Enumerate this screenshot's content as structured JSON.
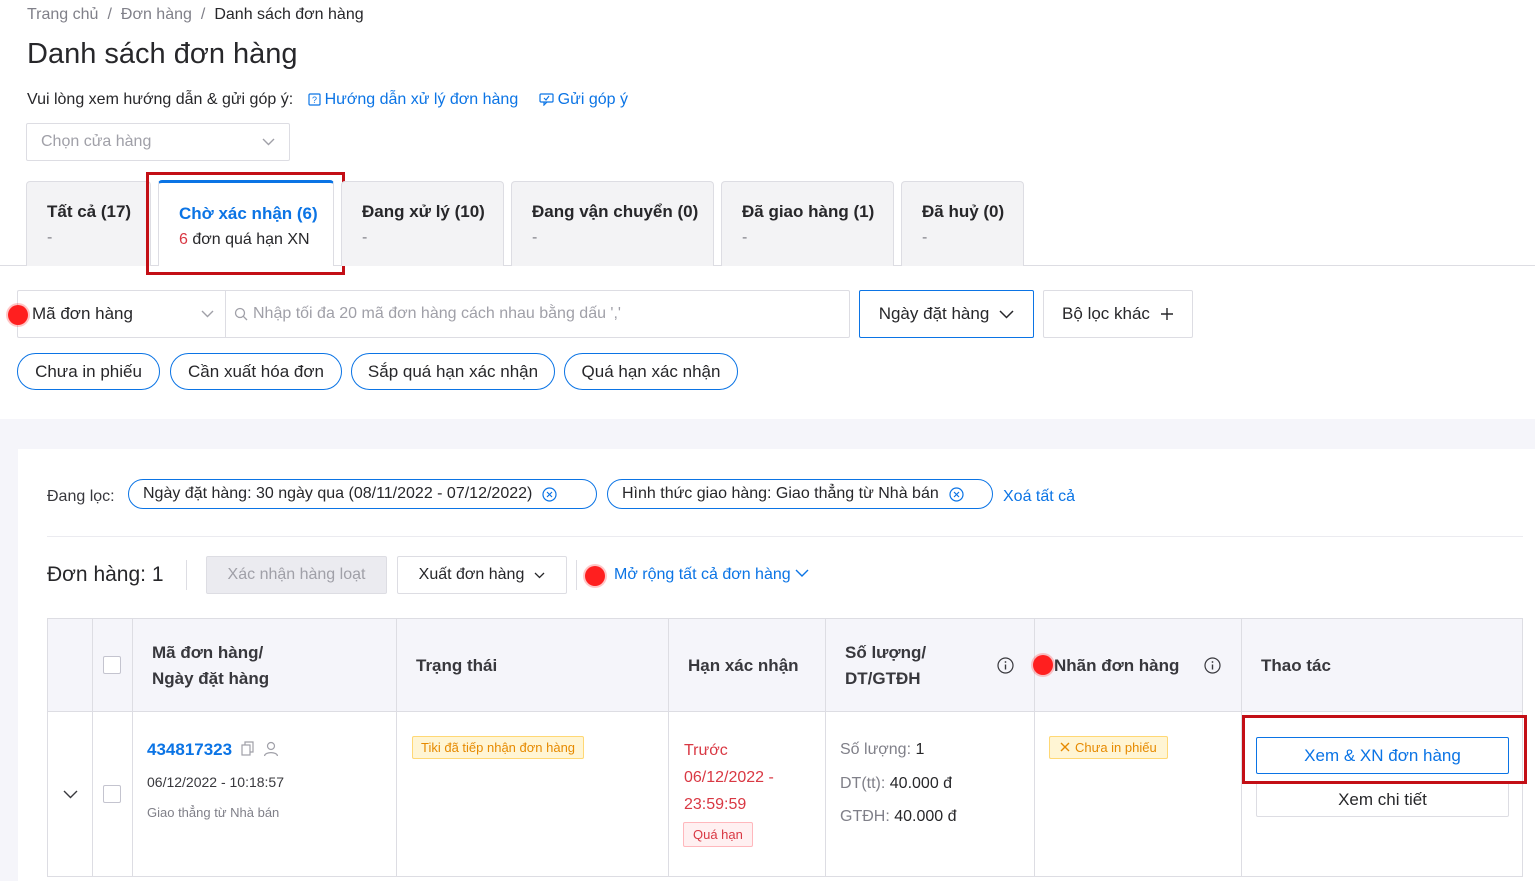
{
  "breadcrumb": {
    "home": "Trang chủ",
    "orders": "Đơn hàng",
    "current": "Danh sách đơn hàng"
  },
  "page_title": "Danh sách đơn hàng",
  "guide": {
    "text": "Vui lòng xem hướng dẫn & gửi góp ý:",
    "link1": "Hướng dẫn xử lý đơn hàng",
    "link2": "Gửi góp ý"
  },
  "store_select": {
    "placeholder": "Chọn cửa hàng"
  },
  "tabs": [
    {
      "label": "Tất cả (17)",
      "sub": "-"
    },
    {
      "label": "Chờ xác nhận (6)",
      "sub_num": "6",
      "sub_text": " đơn quá hạn XN"
    },
    {
      "label": "Đang xử lý (10)",
      "sub": "-"
    },
    {
      "label": "Đang vận chuyển (0)",
      "sub": "-"
    },
    {
      "label": "Đã giao hàng (1)",
      "sub": "-"
    },
    {
      "label": "Đã huỷ (0)",
      "sub": "-"
    }
  ],
  "search": {
    "field_select": "Mã đơn hàng",
    "placeholder": "Nhập tối đa 20 mã đơn hàng cách nhau bằng dấu ','",
    "date_button": "Ngày đặt hàng",
    "more_filters": "Bộ lọc khác"
  },
  "quick_filters": [
    "Chưa in phiếu",
    "Cần xuất hóa đơn",
    "Sắp quá hạn xác nhận",
    "Quá hạn xác nhận"
  ],
  "active_filters": {
    "label": "Đang lọc:",
    "items": [
      "Ngày đặt hàng: 30 ngày qua (08/11/2022 - 07/12/2022)",
      "Hình thức giao hàng: Giao thẳng từ Nhà bán"
    ],
    "clear_all": "Xoá tất cả"
  },
  "toolbar": {
    "order_count": "Đơn hàng: 1",
    "bulk_confirm": "Xác nhận hàng loạt",
    "export": "Xuất đơn hàng",
    "expand_all": "Mở rộng tất cả đơn hàng"
  },
  "table": {
    "headers": {
      "order_line1": "Mã đơn hàng/",
      "order_line2": "Ngày đặt hàng",
      "status": "Trạng thái",
      "deadline": "Hạn xác nhận",
      "qty_line1": "Số lượng/",
      "qty_line2": "DT/GTĐH",
      "label": "Nhãn đơn hàng",
      "actions": "Thao tác"
    },
    "rows": [
      {
        "order_id": "434817323",
        "date": "06/12/2022 - 10:18:57",
        "shipping": "Giao thẳng từ Nhà bán",
        "status": "Tiki đã tiếp nhận đơn hàng",
        "deadline_l1": "Trước",
        "deadline_l2": "06/12/2022 -",
        "deadline_l3": "23:59:59",
        "overdue": "Quá hạn",
        "qty_key": "Số lượng:",
        "qty_val": " 1",
        "dt_key": "DT(tt):",
        "dt_val": " 40.000 đ",
        "gt_key": "GTĐH:",
        "gt_val": " 40.000 đ",
        "label": "Chưa in phiếu",
        "view_confirm": "Xem & XN đơn hàng",
        "view_detail": "Xem chi tiết"
      }
    ]
  },
  "colors": {
    "accent": "#0b74e5",
    "danger": "#d93843",
    "highlight": "#c30f16",
    "marker": "#ff1f1f"
  }
}
